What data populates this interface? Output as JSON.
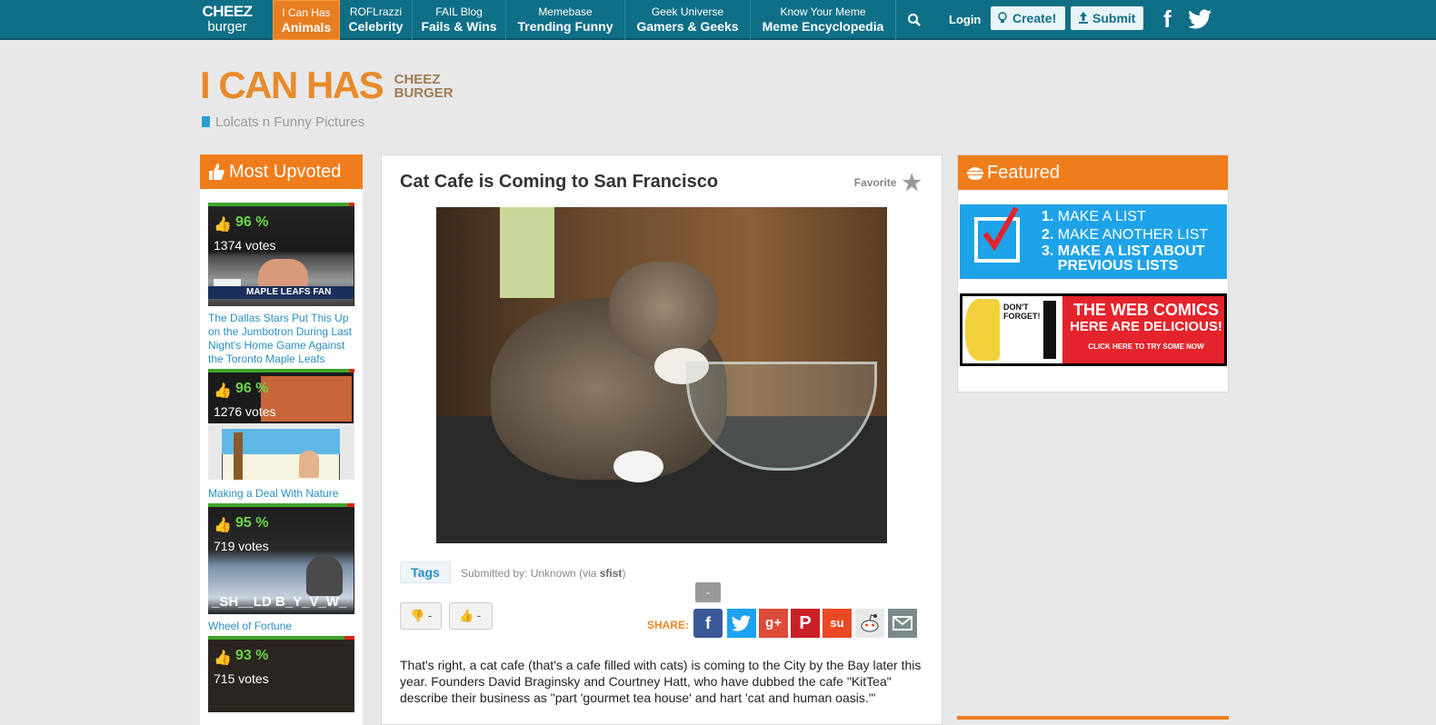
{
  "nav": {
    "logo_line1": "CHEEZ",
    "logo_line2": "burger",
    "items": [
      {
        "small": "I Can Has",
        "big": "Animals"
      },
      {
        "small": "ROFLrazzi",
        "big": "Celebrity"
      },
      {
        "small": "FAIL Blog",
        "big": "Fails & Wins"
      },
      {
        "small": "Memebase",
        "big": "Trending Funny"
      },
      {
        "small": "Geek Universe",
        "big": "Gamers & Geeks"
      },
      {
        "small": "Know Your Meme",
        "big": "Meme Encyclopedia"
      }
    ],
    "login": "Login",
    "create": "Create!",
    "submit": "Submit",
    "social": [
      "facebook-icon",
      "twitter-icon"
    ]
  },
  "site": {
    "title_big": "I CAN HAS",
    "title_small_1": "CHEEZ",
    "title_small_2": "BURGER",
    "tagline": "Lolcats n Funny Pictures"
  },
  "left": {
    "heading": "Most Upvoted",
    "items": [
      {
        "pct": "96 %",
        "votes": "1374 votes",
        "caption": "MAPLE LEAFS FAN",
        "title": "The Dallas Stars Put This Up on the Jumbotron During Last Night's Home Game Against the Toronto Maple Leafs",
        "score": 0.96
      },
      {
        "pct": "96 %",
        "votes": "1276 votes",
        "title": "Making a Deal With Nature",
        "score": 0.96
      },
      {
        "pct": "95 %",
        "votes": "719 votes",
        "caption": "_SH__LD B_Y_V_W_",
        "title": "Wheel of Fortune",
        "score": 0.95
      },
      {
        "pct": "93 %",
        "votes": "715 votes",
        "score": 0.93
      }
    ]
  },
  "post": {
    "title": "Cat Cafe is Coming to San Francisco",
    "favorite": "Favorite",
    "tags": "Tags",
    "submitted_prefix": "Submitted by: Unknown (via ",
    "submitted_by": "sfist",
    "submitted_suffix": ")",
    "downvote": "-",
    "upvote": "-",
    "share_label": "SHARE:",
    "share_count": "-",
    "share_buttons": [
      "facebook",
      "twitter",
      "google-plus",
      "pinterest",
      "stumbleupon",
      "reddit",
      "email"
    ],
    "body": "That's right, a cat cafe (that's a cafe filled with cats) is coming to the City by the Bay later this year. Founders David Braginsky and Courtney Hatt, who have dubbed the cafe \"KitTea\" describe their business as \"part 'gourmet tea house' and hart 'cat and human oasis.'\""
  },
  "right": {
    "heading": "Featured",
    "list_1": "MAKE A LIST",
    "list_2": "MAKE ANOTHER LIST",
    "list_3": "MAKE A LIST ABOUT PREVIOUS LISTS",
    "comics_small_1": "DON'T",
    "comics_small_2": "FORGET!",
    "comics_big_1": "THE WEB COMICS",
    "comics_big_2": "HERE ARE DELICIOUS!",
    "comics_cta": "CLICK HERE TO TRY SOME NOW"
  },
  "colors": {
    "topbar": "#0f6f87",
    "accent": "#f07d1c",
    "link": "#2a8fc3",
    "vote_green": "#3fa52a",
    "vote_red": "#d9261c"
  }
}
